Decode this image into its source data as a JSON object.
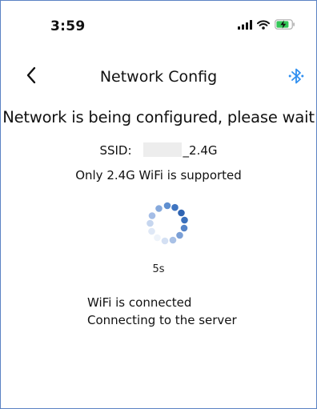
{
  "status_bar": {
    "time": "3:59",
    "icons": [
      "cellular-signal-icon",
      "wifi-icon",
      "battery-charging-icon"
    ],
    "battery_color": "#34c759"
  },
  "nav": {
    "back_icon": "chevron-left-icon",
    "title": "Network Config",
    "bluetooth_icon": "bluetooth-icon",
    "accent": "#2f8ff0"
  },
  "main": {
    "headline": "Network is being configured, please wait",
    "ssid_label": "SSID:",
    "ssid_suffix": "_2.4G",
    "support_note": "Only 2.4G WiFi is supported",
    "spinner_icon": "loading-spinner-icon",
    "countdown": "5s",
    "status_lines": [
      "WiFi is connected",
      "Connecting to the server"
    ]
  }
}
